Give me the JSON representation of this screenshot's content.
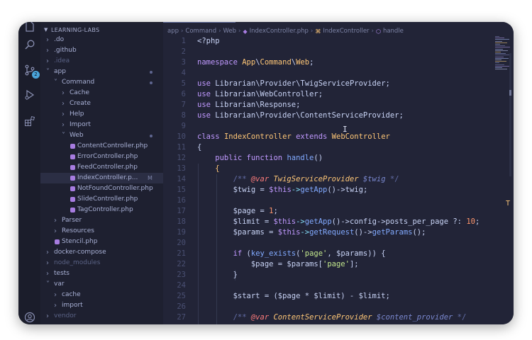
{
  "explorer": {
    "title": "LEARNING-LABS",
    "items": [
      {
        "label": ".do",
        "depth": 0,
        "type": "folder",
        "open": false,
        "dim": false,
        "marker": ""
      },
      {
        "label": ".github",
        "depth": 0,
        "type": "folder",
        "open": false,
        "dim": false,
        "marker": ""
      },
      {
        "label": ".idea",
        "depth": 0,
        "type": "folder",
        "open": false,
        "dim": true,
        "marker": ""
      },
      {
        "label": "app",
        "depth": 0,
        "type": "folder",
        "open": true,
        "dim": false,
        "marker": "dot"
      },
      {
        "label": "Command",
        "depth": 1,
        "type": "folder",
        "open": true,
        "dim": false,
        "marker": "dot"
      },
      {
        "label": "Cache",
        "depth": 2,
        "type": "folder",
        "open": false,
        "dim": false,
        "marker": ""
      },
      {
        "label": "Create",
        "depth": 2,
        "type": "folder",
        "open": false,
        "dim": false,
        "marker": ""
      },
      {
        "label": "Help",
        "depth": 2,
        "type": "folder",
        "open": false,
        "dim": false,
        "marker": ""
      },
      {
        "label": "Import",
        "depth": 2,
        "type": "folder",
        "open": false,
        "dim": false,
        "marker": ""
      },
      {
        "label": "Web",
        "depth": 2,
        "type": "folder",
        "open": true,
        "dim": false,
        "marker": "dot"
      },
      {
        "label": "ContentController.php",
        "depth": 3,
        "type": "file",
        "open": false,
        "dim": false,
        "marker": ""
      },
      {
        "label": "ErrorController.php",
        "depth": 3,
        "type": "file",
        "open": false,
        "dim": false,
        "marker": ""
      },
      {
        "label": "FeedController.php",
        "depth": 3,
        "type": "file",
        "open": false,
        "dim": false,
        "marker": ""
      },
      {
        "label": "IndexController.p...",
        "depth": 3,
        "type": "file",
        "open": false,
        "dim": false,
        "marker": "M",
        "active": true
      },
      {
        "label": "NotFoundController.php",
        "depth": 3,
        "type": "file",
        "open": false,
        "dim": false,
        "marker": ""
      },
      {
        "label": "SlideController.php",
        "depth": 3,
        "type": "file",
        "open": false,
        "dim": false,
        "marker": ""
      },
      {
        "label": "TagController.php",
        "depth": 3,
        "type": "file",
        "open": false,
        "dim": false,
        "marker": ""
      },
      {
        "label": "Parser",
        "depth": 1,
        "type": "folder",
        "open": false,
        "dim": false,
        "marker": ""
      },
      {
        "label": "Resources",
        "depth": 1,
        "type": "folder",
        "open": false,
        "dim": false,
        "marker": ""
      },
      {
        "label": "Stencil.php",
        "depth": 1,
        "type": "file",
        "open": false,
        "dim": false,
        "marker": ""
      },
      {
        "label": "docker-compose",
        "depth": 0,
        "type": "folder",
        "open": false,
        "dim": false,
        "marker": ""
      },
      {
        "label": "node_modules",
        "depth": 0,
        "type": "folder",
        "open": false,
        "dim": true,
        "marker": ""
      },
      {
        "label": "tests",
        "depth": 0,
        "type": "folder",
        "open": false,
        "dim": false,
        "marker": ""
      },
      {
        "label": "var",
        "depth": 0,
        "type": "folder",
        "open": true,
        "dim": false,
        "marker": ""
      },
      {
        "label": "cache",
        "depth": 1,
        "type": "folder",
        "open": false,
        "dim": false,
        "marker": ""
      },
      {
        "label": "import",
        "depth": 1,
        "type": "folder",
        "open": false,
        "dim": false,
        "marker": ""
      },
      {
        "label": "vendor",
        "depth": 0,
        "type": "folder",
        "open": false,
        "dim": true,
        "marker": ""
      }
    ]
  },
  "activity": {
    "icons": [
      "files-icon",
      "search-icon",
      "source-control-icon",
      "run-debug-icon",
      "extensions-icon",
      "account-icon"
    ],
    "scm_badge": "2"
  },
  "breadcrumb": [
    "app",
    "Command",
    "Web",
    "IndexController.php",
    "IndexController",
    "handle"
  ],
  "editor": {
    "line_numbers": [
      "1",
      "2",
      "3",
      "4",
      "5",
      "6",
      "7",
      "8",
      "9",
      "10",
      "11",
      "12",
      "13",
      "14",
      "15",
      "16",
      "17",
      "18",
      "19",
      "20",
      "21",
      "22",
      "23",
      "24",
      "25",
      "26",
      "27"
    ],
    "overflow_glyph": "T",
    "lines": [
      [
        [
          "<?php",
          "t"
        ]
      ],
      [],
      [
        [
          "namespace ",
          "k"
        ],
        [
          "App",
          "c"
        ],
        [
          "\\",
          "t"
        ],
        [
          "Command",
          "c"
        ],
        [
          "\\",
          "t"
        ],
        [
          "Web",
          "c"
        ],
        [
          ";",
          "t"
        ]
      ],
      [],
      [
        [
          "use ",
          "k"
        ],
        [
          "Librarian\\Provider\\TwigServiceProvider;",
          "t"
        ]
      ],
      [
        [
          "use ",
          "k"
        ],
        [
          "Librarian\\WebController;",
          "t"
        ]
      ],
      [
        [
          "use ",
          "k"
        ],
        [
          "Librarian\\Response;",
          "t"
        ]
      ],
      [
        [
          "use ",
          "k"
        ],
        [
          "Librarian\\Provider\\ContentServiceProvider;",
          "t"
        ]
      ],
      [],
      [
        [
          "class ",
          "k"
        ],
        [
          "IndexController ",
          "c"
        ],
        [
          "extends ",
          "k"
        ],
        [
          "WebController",
          "c"
        ]
      ],
      [
        [
          "{",
          "t"
        ]
      ],
      [
        [
          "    public function ",
          "k"
        ],
        [
          "handle",
          "f"
        ],
        [
          "()",
          "t"
        ]
      ],
      [
        [
          "    {",
          "y"
        ]
      ],
      [
        [
          "        /** ",
          "m"
        ],
        [
          "@var ",
          "a"
        ],
        [
          "TwigServiceProvider ",
          "v"
        ],
        [
          "$twig ",
          "n"
        ],
        [
          "*/",
          "m"
        ]
      ],
      [
        [
          "        $twig = ",
          "t"
        ],
        [
          "$this",
          "k"
        ],
        [
          "->",
          "o"
        ],
        [
          "getApp",
          "f"
        ],
        [
          "()->",
          "t"
        ],
        [
          "twig;",
          "t"
        ]
      ],
      [],
      [
        [
          "        $page = ",
          "t"
        ],
        [
          "1",
          "h"
        ],
        [
          ";",
          "t"
        ]
      ],
      [
        [
          "        $limit = ",
          "t"
        ],
        [
          "$this",
          "k"
        ],
        [
          "->",
          "o"
        ],
        [
          "getApp",
          "f"
        ],
        [
          "()->config->posts_per_page ?: ",
          "t"
        ],
        [
          "10",
          "h"
        ],
        [
          ";",
          "t"
        ]
      ],
      [
        [
          "        $params = ",
          "t"
        ],
        [
          "$this",
          "k"
        ],
        [
          "->",
          "o"
        ],
        [
          "getRequest",
          "f"
        ],
        [
          "()->",
          "t"
        ],
        [
          "getParams",
          "f"
        ],
        [
          "();",
          "t"
        ]
      ],
      [],
      [
        [
          "        if ",
          "k"
        ],
        [
          "(",
          "t"
        ],
        [
          "key_exists",
          "f"
        ],
        [
          "(",
          "t"
        ],
        [
          "'page'",
          "s"
        ],
        [
          ", $params)) {",
          "t"
        ]
      ],
      [
        [
          "            $page = $params[",
          "t"
        ],
        [
          "'page'",
          "s"
        ],
        [
          "];",
          "t"
        ]
      ],
      [
        [
          "        }",
          "t"
        ]
      ],
      [],
      [
        [
          "        $start = ($page * $limit) - $limit;",
          "t"
        ]
      ],
      [],
      [
        [
          "        /** ",
          "m"
        ],
        [
          "@var ",
          "a"
        ],
        [
          "ContentServiceProvider ",
          "v"
        ],
        [
          "$content_provider ",
          "n"
        ],
        [
          "*/",
          "m"
        ]
      ]
    ]
  },
  "colors": {
    "t": "#c8d3f5",
    "k": "#c099ff",
    "c": "#ffc777",
    "f": "#82aaff",
    "s": "#c3e88d",
    "h": "#ff966c",
    "m": "#636da6",
    "a": "#fc7b7b",
    "v": "#ffc777",
    "n": "#7a88cf",
    "o": "#86e1fc",
    "y": "#ffc777"
  }
}
